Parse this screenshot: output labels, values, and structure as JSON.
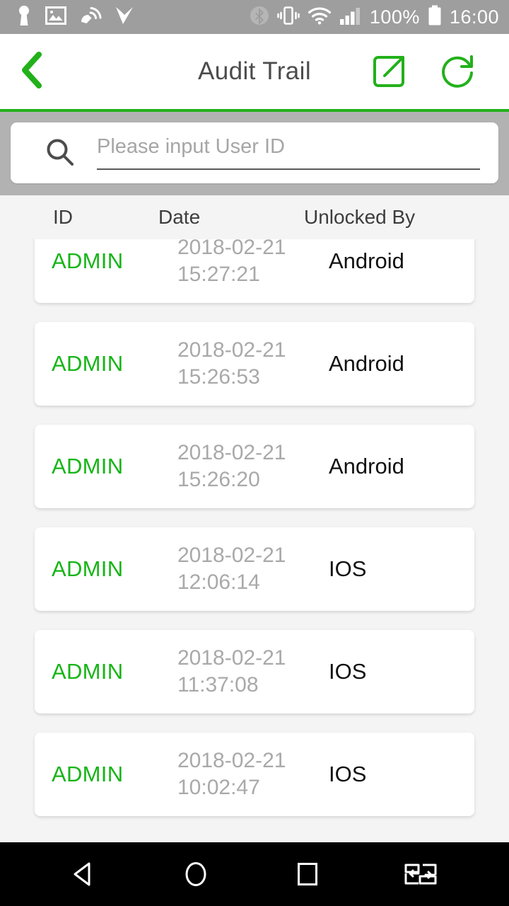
{
  "status_bar": {
    "left_icons": [
      "keyhole-icon",
      "photo-icon",
      "satellite-signal-icon",
      "check-play-icon"
    ],
    "right_icons": [
      "bluetooth-icon",
      "vibrate-icon",
      "wifi-icon",
      "cellular-signal-icon"
    ],
    "battery_percent": "100%",
    "battery_icon": "battery-full-icon",
    "clock": "16:00"
  },
  "app_bar": {
    "back_icon": "back-chevron-icon",
    "title": "Audit Trail",
    "export_icon": "export-share-icon",
    "refresh_icon": "refresh-icon",
    "accent_color": "#22b11a"
  },
  "search": {
    "icon": "search-icon",
    "value": "",
    "placeholder": "Please input User ID"
  },
  "table": {
    "headers": {
      "id": "ID",
      "date": "Date",
      "unlocked_by": "Unlocked By"
    },
    "rows": [
      {
        "id": "ADMIN",
        "date": "2018-02-21",
        "time": "15:27:21",
        "unlocked_by": "Android"
      },
      {
        "id": "ADMIN",
        "date": "2018-02-21",
        "time": "15:26:53",
        "unlocked_by": "Android"
      },
      {
        "id": "ADMIN",
        "date": "2018-02-21",
        "time": "15:26:20",
        "unlocked_by": "Android"
      },
      {
        "id": "ADMIN",
        "date": "2018-02-21",
        "time": "12:06:14",
        "unlocked_by": "IOS"
      },
      {
        "id": "ADMIN",
        "date": "2018-02-21",
        "time": "11:37:08",
        "unlocked_by": "IOS"
      },
      {
        "id": "ADMIN",
        "date": "2018-02-21",
        "time": "10:02:47",
        "unlocked_by": "IOS"
      }
    ],
    "id_color": "#16b516",
    "date_color": "#a9a9a9",
    "unlocked_by_color": "#111111"
  },
  "nav_bar": {
    "icons": [
      "back-triangle-icon",
      "home-circle-icon",
      "recents-square-icon",
      "split-screen-icon"
    ]
  }
}
